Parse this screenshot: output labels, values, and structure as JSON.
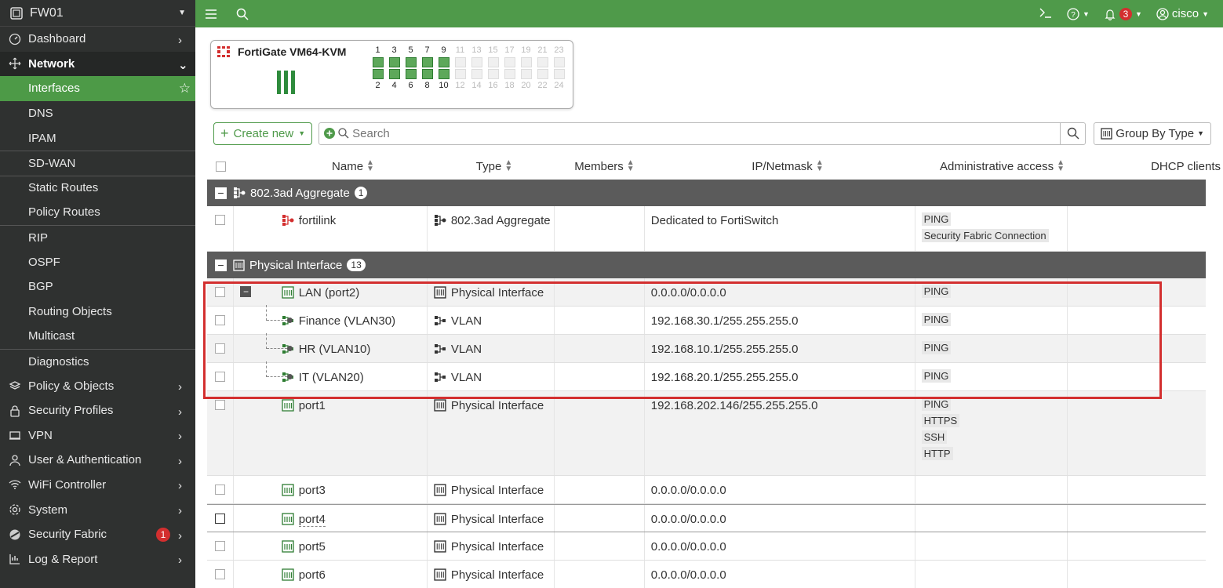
{
  "sidebar": {
    "device": "FW01",
    "items": [
      {
        "label": "Dashboard",
        "icon": "dashboard-icon"
      },
      {
        "label": "Network",
        "icon": "network-icon"
      },
      {
        "label": "Interfaces"
      },
      {
        "label": "DNS"
      },
      {
        "label": "IPAM"
      },
      {
        "label": "SD-WAN"
      },
      {
        "label": "Static Routes"
      },
      {
        "label": "Policy Routes"
      },
      {
        "label": "RIP"
      },
      {
        "label": "OSPF"
      },
      {
        "label": "BGP"
      },
      {
        "label": "Routing Objects"
      },
      {
        "label": "Multicast"
      },
      {
        "label": "Diagnostics"
      },
      {
        "label": "Policy & Objects",
        "icon": "policy-icon"
      },
      {
        "label": "Security Profiles",
        "icon": "lock-icon"
      },
      {
        "label": "VPN",
        "icon": "vpn-icon"
      },
      {
        "label": "User & Authentication",
        "icon": "user-icon"
      },
      {
        "label": "WiFi Controller",
        "icon": "wifi-icon"
      },
      {
        "label": "System",
        "icon": "gear-icon"
      },
      {
        "label": "Security Fabric",
        "icon": "fabric-icon",
        "badge": "1"
      },
      {
        "label": "Log & Report",
        "icon": "report-icon"
      }
    ]
  },
  "topbar": {
    "notif_count": "3",
    "user": "cisco"
  },
  "device": {
    "title": "FortiGate VM64-KVM",
    "top_ports": [
      "1",
      "3",
      "5",
      "7",
      "9",
      "11",
      "13",
      "15",
      "17",
      "19",
      "21",
      "23"
    ],
    "bottom_ports": [
      "2",
      "4",
      "6",
      "8",
      "10",
      "12",
      "14",
      "16",
      "18",
      "20",
      "22",
      "24"
    ],
    "active_count": 5
  },
  "toolbar": {
    "create_label": "Create new",
    "search_placeholder": "Search",
    "group_by_label": "Group By Type"
  },
  "table": {
    "headers": {
      "name": "Name",
      "type": "Type",
      "members": "Members",
      "ip": "IP/Netmask",
      "admin": "Administrative access",
      "dhcp": "DHCP clients"
    },
    "groups": [
      {
        "label": "802.3ad Aggregate",
        "count": "1",
        "rows": [
          {
            "name": "fortilink",
            "type": "802.3ad Aggregate",
            "ip": "Dedicated to FortiSwitch",
            "access": [
              "PING",
              "Security Fabric Connection"
            ]
          }
        ]
      },
      {
        "label": "Physical Interface",
        "count": "13",
        "rows": [
          {
            "name": "LAN (port2)",
            "type": "Physical Interface",
            "ip": "0.0.0.0/0.0.0.0",
            "access": [
              "PING"
            ]
          },
          {
            "name": "Finance (VLAN30)",
            "type": "VLAN",
            "ip": "192.168.30.1/255.255.255.0",
            "access": [
              "PING"
            ]
          },
          {
            "name": "HR (VLAN10)",
            "type": "VLAN",
            "ip": "192.168.10.1/255.255.255.0",
            "access": [
              "PING"
            ]
          },
          {
            "name": "IT (VLAN20)",
            "type": "VLAN",
            "ip": "192.168.20.1/255.255.255.0",
            "access": [
              "PING"
            ]
          },
          {
            "name": "port1",
            "type": "Physical Interface",
            "ip": "192.168.202.146/255.255.255.0",
            "access": [
              "PING",
              "HTTPS",
              "SSH",
              "HTTP"
            ]
          },
          {
            "name": "port3",
            "type": "Physical Interface",
            "ip": "0.0.0.0/0.0.0.0",
            "access": []
          },
          {
            "name": "port4",
            "type": "Physical Interface",
            "ip": "0.0.0.0/0.0.0.0",
            "access": []
          },
          {
            "name": "port5",
            "type": "Physical Interface",
            "ip": "0.0.0.0/0.0.0.0",
            "access": []
          },
          {
            "name": "port6",
            "type": "Physical Interface",
            "ip": "0.0.0.0/0.0.0.0",
            "access": []
          }
        ]
      }
    ]
  },
  "colors": {
    "brand_green": "#4f9a4a",
    "sidebar_bg": "#2f3130",
    "group_header": "#5b5b5b",
    "highlight_red": "#d32f2f"
  }
}
